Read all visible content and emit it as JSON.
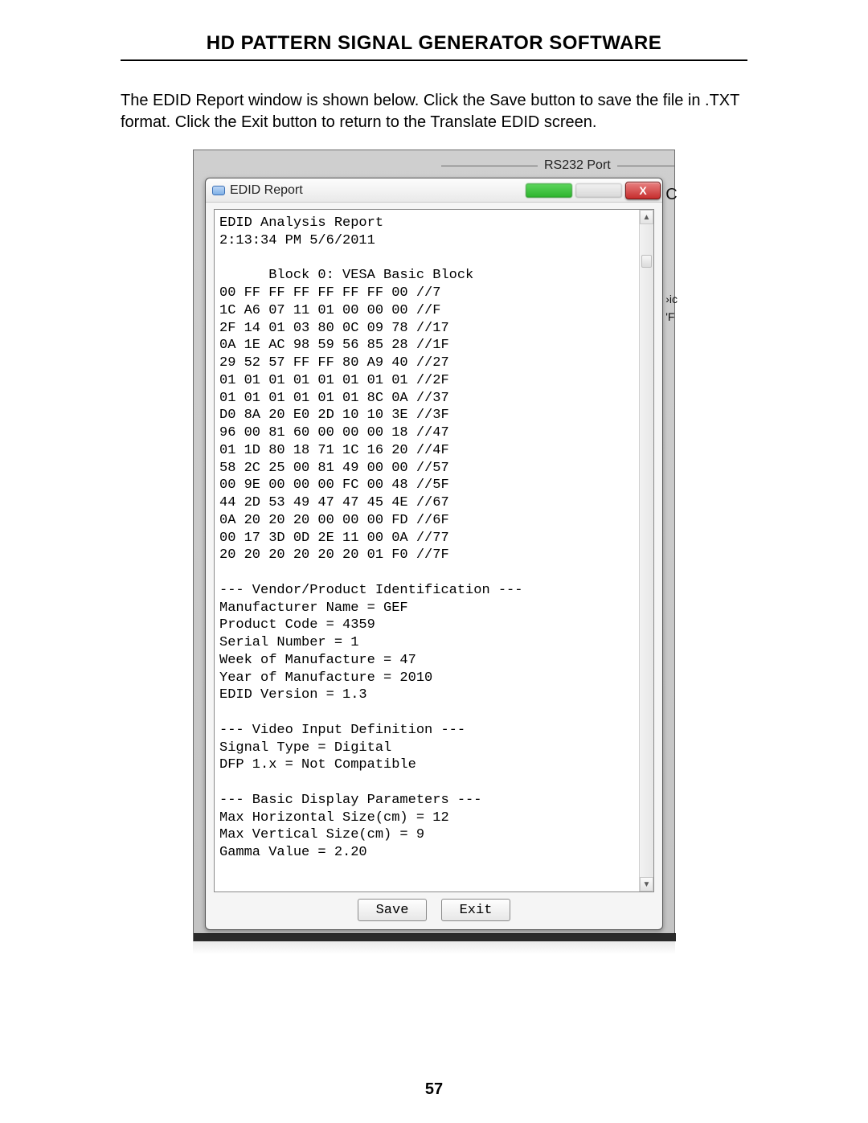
{
  "doc": {
    "heading": "HD PATTERN SIGNAL GENERATOR SOFTWARE",
    "intro": "The EDID Report window is shown below.  Click the Save button to save the file in .TXT format.  Click the Exit button to return to the Translate EDID screen.",
    "page_number": "57"
  },
  "background": {
    "groupbox_label": "RS232 Port",
    "rt1": "C",
    "rt2": "›ic",
    "rt3": "'F"
  },
  "window": {
    "title": "EDID Report",
    "close_glyph": "X",
    "scroll_up_glyph": "▲",
    "scroll_down_glyph": "▼",
    "buttons": {
      "save": "Save",
      "exit": "Exit"
    },
    "report_text": "EDID Analysis Report\n2:13:34 PM 5/6/2011\n\n      Block 0: VESA Basic Block      \n00 FF FF FF FF FF FF 00 //7\n1C A6 07 11 01 00 00 00 //F\n2F 14 01 03 80 0C 09 78 //17\n0A 1E AC 98 59 56 85 28 //1F\n29 52 57 FF FF 80 A9 40 //27\n01 01 01 01 01 01 01 01 //2F\n01 01 01 01 01 01 8C 0A //37\nD0 8A 20 E0 2D 10 10 3E //3F\n96 00 81 60 00 00 00 18 //47\n01 1D 80 18 71 1C 16 20 //4F\n58 2C 25 00 81 49 00 00 //57\n00 9E 00 00 00 FC 00 48 //5F\n44 2D 53 49 47 47 45 4E //67\n0A 20 20 20 00 00 00 FD //6F\n00 17 3D 0D 2E 11 00 0A //77\n20 20 20 20 20 20 01 F0 //7F\n\n--- Vendor/Product Identification ---\nManufacturer Name = GEF\nProduct Code = 4359\nSerial Number = 1\nWeek of Manufacture = 47\nYear of Manufacture = 2010\nEDID Version = 1.3\n\n--- Video Input Definition ---\nSignal Type = Digital\nDFP 1.x = Not Compatible\n\n--- Basic Display Parameters ---\nMax Horizontal Size(cm) = 12\nMax Vertical Size(cm) = 9\nGamma Value = 2.20"
  }
}
